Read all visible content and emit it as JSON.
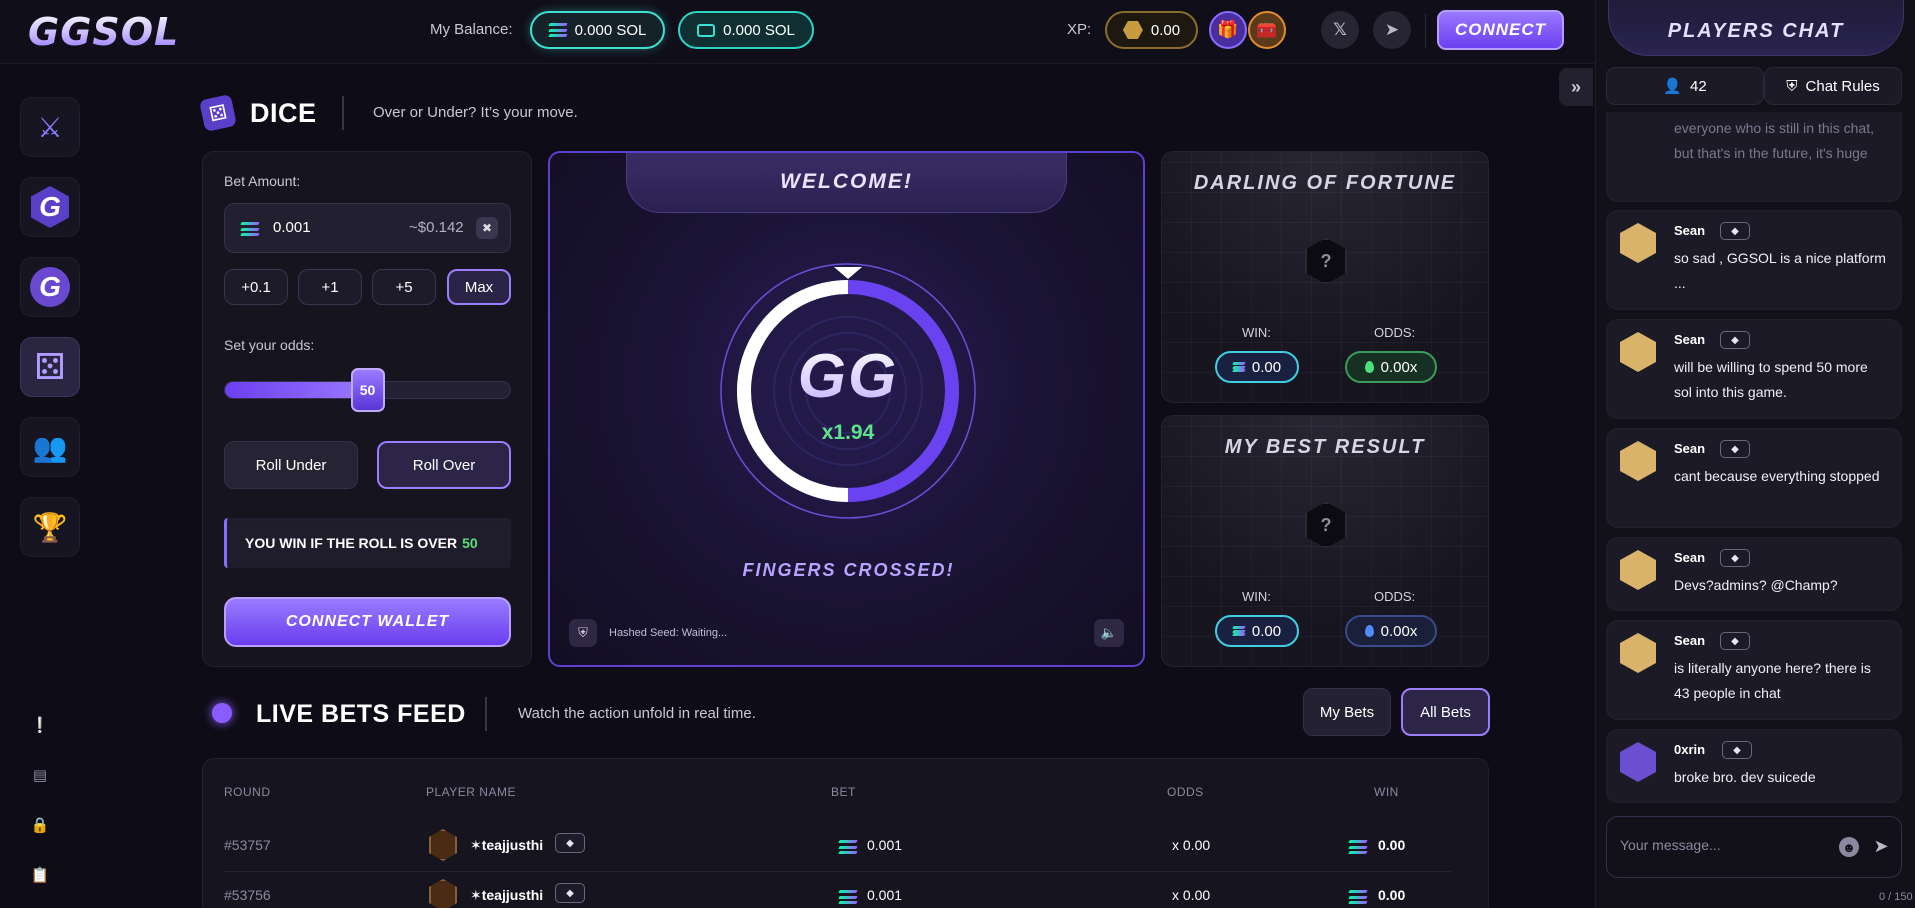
{
  "topbar": {
    "logo": "GGSOL",
    "balance_label": "My Balance:",
    "sol_balance": "0.000 SOL",
    "ticket_balance": "0.000 SOL",
    "xp_label": "XP:",
    "xp_value": "0.00",
    "x_glyph": "𝕏",
    "connect_label": "CONNECT",
    "icons": [
      "solana-icon",
      "ticket-icon",
      "xp-icon",
      "gift-icon",
      "chest-icon",
      "x-icon",
      "telegram-icon"
    ]
  },
  "sidebar": {
    "items": [
      {
        "name": "swords-icon",
        "glyph": "⚔"
      },
      {
        "name": "g-coin-icon",
        "glyph": "G"
      },
      {
        "name": "g-token-icon",
        "glyph": "G"
      },
      {
        "name": "dice-icon",
        "glyph": "⚄"
      },
      {
        "name": "users-icon",
        "glyph": "👥"
      },
      {
        "name": "trophy-icon",
        "glyph": "🏆"
      }
    ],
    "bottom": [
      {
        "name": "feedback-icon",
        "glyph": "❕"
      },
      {
        "name": "document-icon",
        "glyph": "▤"
      },
      {
        "name": "lock-icon",
        "glyph": "🔒"
      },
      {
        "name": "clipboard-icon",
        "glyph": "📋"
      }
    ]
  },
  "dice": {
    "title": "DICE",
    "subtitle": "Over or Under? It’s your move."
  },
  "bet": {
    "amount_label": "Bet Amount:",
    "amount_value": "0.001",
    "amount_usd": "~$0.142",
    "chips": [
      "+0.1",
      "+1",
      "+5",
      "Max"
    ],
    "odds_label": "Set your odds:",
    "odds_value": "50",
    "odds_percent": 50,
    "roll_under": "Roll Under",
    "roll_over": "Roll Over",
    "win_text": "YOU WIN IF THE ROLL IS OVER",
    "win_number": "50",
    "cta": "CONNECT WALLET"
  },
  "game": {
    "welcome": "WELCOME!",
    "logo": "GG",
    "multiplier": "x1.94",
    "status": "FINGERS CROSSED!",
    "seed": "Hashed Seed: Waiting...",
    "ring_fraction": 0.5
  },
  "fortune": {
    "title": "DARLING OF FORTUNE",
    "win_label": "WIN:",
    "odds_label": "ODDS:",
    "win_value": "0.00",
    "odds_value": "0.00x"
  },
  "best": {
    "title": "MY BEST RESULT",
    "win_label": "WIN:",
    "odds_label": "ODDS:",
    "win_value": "0.00",
    "odds_value": "0.00x"
  },
  "live": {
    "title": "LIVE BETS FEED",
    "subtitle": "Watch the action unfold in real time.",
    "tab_my": "My Bets",
    "tab_all": "All Bets",
    "columns": [
      "ROUND",
      "PLAYER NAME",
      "BET",
      "ODDS",
      "WIN"
    ],
    "rows": [
      {
        "round": "#53757",
        "player": "✶teajjusthi",
        "bet": "0.001",
        "odds": "x 0.00",
        "win": "0.00"
      },
      {
        "round": "#53756",
        "player": "✶teajjusthi",
        "bet": "0.001",
        "odds": "x 0.00",
        "win": "0.00"
      }
    ]
  },
  "chat": {
    "title": "PLAYERS CHAT",
    "online": "42",
    "rules": "Chat Rules",
    "faded": "everyone who is still in this chat, but that's in the future, it's huge",
    "messages": [
      {
        "name": "Sean",
        "text": "so sad , GGSOL is a nice platform ..."
      },
      {
        "name": "Sean",
        "text": "will be willing to spend 50 more sol into this game."
      },
      {
        "name": "Sean",
        "text": "cant because everything stopped"
      },
      {
        "name": "Sean",
        "text": "Devs?admins? @Champ?"
      },
      {
        "name": "Sean",
        "text": "is literally anyone here? there is 43 people in chat"
      },
      {
        "name": "0xrin",
        "text": "broke bro. dev suicede"
      }
    ],
    "placeholder": "Your message...",
    "counter": "0 / 150"
  },
  "colors": {
    "accent": "#8a6cff",
    "win_green": "#5ce07a",
    "teal": "#3fe0d0"
  }
}
